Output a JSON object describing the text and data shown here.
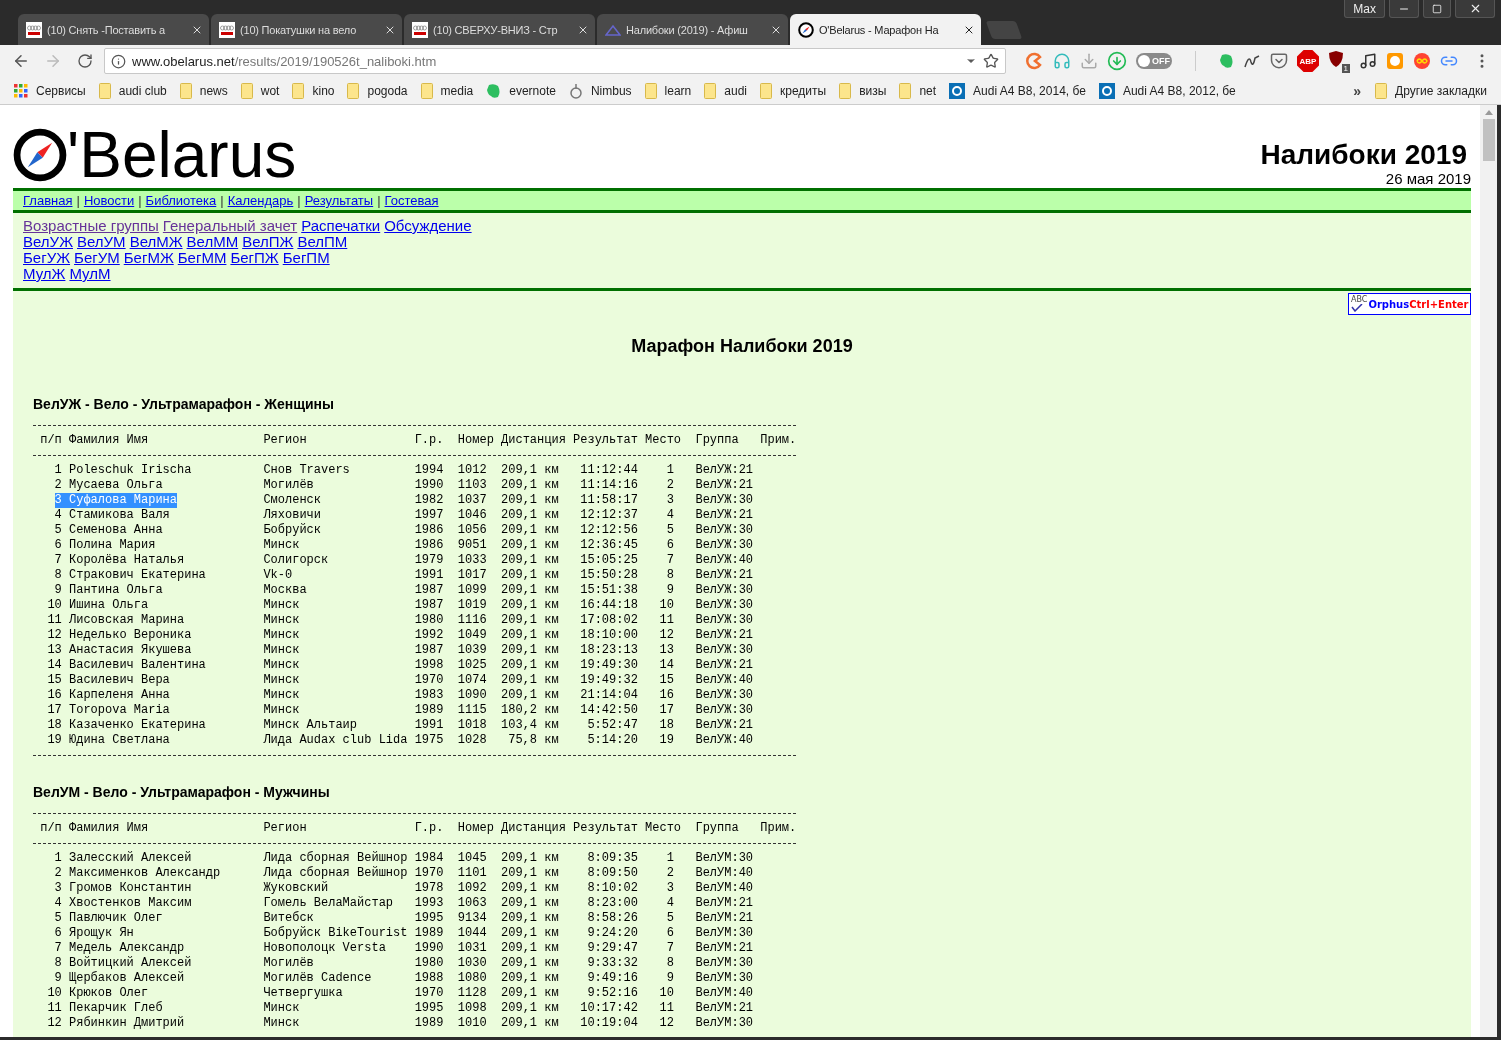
{
  "browser": {
    "profile": "Max",
    "tabs": [
      {
        "title": "(10) Снять -Поставить а",
        "kind": "audi",
        "selected": false
      },
      {
        "title": "(10) Покатушки на вело",
        "kind": "audi",
        "selected": false
      },
      {
        "title": "(10) СВЕРХУ-ВНИЗ - Стр",
        "kind": "audi",
        "selected": false
      },
      {
        "title": "Налибоки (2019) - Афиш",
        "kind": "afisha",
        "selected": false
      },
      {
        "title": "O'Belarus - Марафон На",
        "kind": "compass",
        "selected": true
      }
    ],
    "url": {
      "host": "www.obelarus.net",
      "path": "/results/2019/190526t_naliboki.htm"
    },
    "toggle": {
      "label": "OFF",
      "on": false
    },
    "abp": "ABP",
    "ublock_badge": "1",
    "bookmarks": [
      {
        "label": "Сервисы",
        "kind": "apps"
      },
      {
        "label": "audi club",
        "kind": "folder"
      },
      {
        "label": "news",
        "kind": "folder"
      },
      {
        "label": "wot",
        "kind": "folder"
      },
      {
        "label": "kino",
        "kind": "folder"
      },
      {
        "label": "pogoda",
        "kind": "folder"
      },
      {
        "label": "media",
        "kind": "folder"
      },
      {
        "label": "evernote",
        "kind": "evernote"
      },
      {
        "label": "Nimbus",
        "kind": "nimbus"
      },
      {
        "label": "learn",
        "kind": "folder"
      },
      {
        "label": "audi",
        "kind": "folder"
      },
      {
        "label": "кредиты",
        "kind": "folder"
      },
      {
        "label": "визы",
        "kind": "folder"
      },
      {
        "label": "net",
        "kind": "folder"
      },
      {
        "label": "Audi A4 B8, 2014, бе",
        "kind": "site"
      },
      {
        "label": "Audi A4 B8, 2012, бе",
        "kind": "site"
      }
    ],
    "more_bookmarks": "»",
    "other_bookmarks": "Другие закладки"
  },
  "page": {
    "logo": "'Belarus",
    "event_title": "Налибоки 2019",
    "event_date": "26 мая 2019",
    "nav": {
      "separator": "|",
      "links": [
        "Главная",
        "Новости",
        "Библиотека",
        "Календарь",
        "Результаты",
        "Гостевая"
      ]
    },
    "subnav": [
      [
        {
          "label": "Возрастные группы",
          "visited": true
        },
        {
          "label": "Генеральный зачет",
          "visited": true
        },
        {
          "label": "Распечатки",
          "visited": false
        },
        {
          "label": "Обсуждение",
          "visited": false
        }
      ],
      [
        {
          "label": "ВелУЖ",
          "visited": false
        },
        {
          "label": "ВелУМ",
          "visited": false
        },
        {
          "label": "ВелМЖ",
          "visited": false
        },
        {
          "label": "ВелММ",
          "visited": false
        },
        {
          "label": "ВелПЖ",
          "visited": false
        },
        {
          "label": "ВелПМ",
          "visited": false
        }
      ],
      [
        {
          "label": "БегУЖ",
          "visited": false
        },
        {
          "label": "БегУМ",
          "visited": false
        },
        {
          "label": "БегМЖ",
          "visited": false
        },
        {
          "label": "БегММ",
          "visited": false
        },
        {
          "label": "БегПЖ",
          "visited": false
        },
        {
          "label": "БегПМ",
          "visited": false
        }
      ],
      [
        {
          "label": "МулЖ",
          "visited": false
        },
        {
          "label": "МулМ",
          "visited": false
        }
      ]
    ],
    "orphus": {
      "icon_text": "ABC",
      "label": "Orphus",
      "shortcut": "Ctrl+Enter"
    },
    "heading": "Марафон Налибоки 2019",
    "sections": [
      {
        "title": "ВелУЖ - Вело - Ультрамарафон - Женщины",
        "columns": [
          "п/п",
          "Фамилия Имя",
          "Регион",
          "Г.р.",
          "Номер",
          "Дистанция",
          "Результат",
          "Место",
          "Группа",
          "Прим."
        ],
        "rows": [
          {
            "cells": [
              "1",
              "Poleschuk Irischa",
              "Снов Travers",
              "1994",
              "1012",
              "209,1 км",
              "11:12:44",
              "1",
              "ВелУЖ:21"
            ],
            "selected": false
          },
          {
            "cells": [
              "2",
              "Мусаева Ольга",
              "Могилёв",
              "1990",
              "1103",
              "209,1 км",
              "11:14:16",
              "2",
              "ВелУЖ:21"
            ],
            "selected": false
          },
          {
            "cells": [
              "3",
              "Суфалова Марина",
              "Смоленск",
              "1982",
              "1037",
              "209,1 км",
              "11:58:17",
              "3",
              "ВелУЖ:30"
            ],
            "selected": true
          },
          {
            "cells": [
              "4",
              "Стамикова Валя",
              "Ляховичи",
              "1997",
              "1046",
              "209,1 км",
              "12:12:37",
              "4",
              "ВелУЖ:21"
            ],
            "selected": false
          },
          {
            "cells": [
              "5",
              "Семенова Анна",
              "Бобруйск",
              "1986",
              "1056",
              "209,1 км",
              "12:12:56",
              "5",
              "ВелУЖ:30"
            ],
            "selected": false
          },
          {
            "cells": [
              "6",
              "Полина Мария",
              "Минск",
              "1986",
              "9051",
              "209,1 км",
              "12:36:45",
              "6",
              "ВелУЖ:30"
            ],
            "selected": false
          },
          {
            "cells": [
              "7",
              "Королёва Наталья",
              "Солигорск",
              "1979",
              "1033",
              "209,1 км",
              "15:05:25",
              "7",
              "ВелУЖ:40"
            ],
            "selected": false
          },
          {
            "cells": [
              "8",
              "Стракович Екатерина",
              "Vk-0",
              "1991",
              "1017",
              "209,1 км",
              "15:50:28",
              "8",
              "ВелУЖ:21"
            ],
            "selected": false
          },
          {
            "cells": [
              "9",
              "Пантина Ольга",
              "Москва",
              "1987",
              "1099",
              "209,1 км",
              "15:51:38",
              "9",
              "ВелУЖ:30"
            ],
            "selected": false
          },
          {
            "cells": [
              "10",
              "Ишина Ольга",
              "Минск",
              "1987",
              "1019",
              "209,1 км",
              "16:44:18",
              "10",
              "ВелУЖ:30"
            ],
            "selected": false
          },
          {
            "cells": [
              "11",
              "Лисовская Марина",
              "Минск",
              "1980",
              "1116",
              "209,1 км",
              "17:08:02",
              "11",
              "ВелУЖ:30"
            ],
            "selected": false
          },
          {
            "cells": [
              "12",
              "Неделько Вероника",
              "Минск",
              "1992",
              "1049",
              "209,1 км",
              "18:10:00",
              "12",
              "ВелУЖ:21"
            ],
            "selected": false
          },
          {
            "cells": [
              "13",
              "Анастасия Якушева",
              "Минск",
              "1987",
              "1039",
              "209,1 км",
              "18:23:13",
              "13",
              "ВелУЖ:30"
            ],
            "selected": false
          },
          {
            "cells": [
              "14",
              "Василевич Валентина",
              "Минск",
              "1998",
              "1025",
              "209,1 км",
              "19:49:30",
              "14",
              "ВелУЖ:21"
            ],
            "selected": false
          },
          {
            "cells": [
              "15",
              "Василевич Вера",
              "Минск",
              "1970",
              "1074",
              "209,1 км",
              "19:49:32",
              "15",
              "ВелУЖ:40"
            ],
            "selected": false
          },
          {
            "cells": [
              "16",
              "Карпеленя Анна",
              "Минск",
              "1983",
              "1090",
              "209,1 км",
              "21:14:04",
              "16",
              "ВелУЖ:30"
            ],
            "selected": false
          },
          {
            "cells": [
              "17",
              "Toropova Maria",
              "Минск",
              "1989",
              "1115",
              "180,2 км",
              "14:42:50",
              "17",
              "ВелУЖ:30"
            ],
            "selected": false
          },
          {
            "cells": [
              "18",
              "Казаченко Екатерина",
              "Минск Альтаир",
              "1991",
              "1018",
              "103,4 км",
              "5:52:47",
              "18",
              "ВелУЖ:21"
            ],
            "selected": false
          },
          {
            "cells": [
              "19",
              "Юдина Светлана",
              "Лида Audax club Lida",
              "1975",
              "1028",
              "75,8 км",
              "5:14:20",
              "19",
              "ВелУЖ:40"
            ],
            "selected": false
          }
        ]
      },
      {
        "title": "ВелУМ - Вело - Ультрамарафон - Мужчины",
        "columns": [
          "п/п",
          "Фамилия Имя",
          "Регион",
          "Г.р.",
          "Номер",
          "Дистанция",
          "Результат",
          "Место",
          "Группа",
          "Прим."
        ],
        "rows": [
          {
            "cells": [
              "1",
              "Залесский Алексей",
              "Лида сборная Вейшнор",
              "1984",
              "1045",
              "209,1 км",
              "8:09:35",
              "1",
              "ВелУМ:30"
            ],
            "selected": false
          },
          {
            "cells": [
              "2",
              "Максименков Александр",
              "Лида сборная Вейшнор",
              "1970",
              "1101",
              "209,1 км",
              "8:09:50",
              "2",
              "ВелУМ:40"
            ],
            "selected": false
          },
          {
            "cells": [
              "3",
              "Громов Константин",
              "Жуковский",
              "1978",
              "1092",
              "209,1 км",
              "8:10:02",
              "3",
              "ВелУМ:40"
            ],
            "selected": false
          },
          {
            "cells": [
              "4",
              "Хвостенков Максим",
              "Гомель ВелаМайстар",
              "1993",
              "1063",
              "209,1 км",
              "8:23:00",
              "4",
              "ВелУМ:21"
            ],
            "selected": false
          },
          {
            "cells": [
              "5",
              "Павлючик Олег",
              "Витебск",
              "1995",
              "9134",
              "209,1 км",
              "8:58:26",
              "5",
              "ВелУМ:21"
            ],
            "selected": false
          },
          {
            "cells": [
              "6",
              "Ярощук Ян",
              "Бобруйск BikeTourist",
              "1989",
              "1044",
              "209,1 км",
              "9:24:20",
              "6",
              "ВелУМ:30"
            ],
            "selected": false
          },
          {
            "cells": [
              "7",
              "Медель Александр",
              "Новополоцк Versta",
              "1990",
              "1031",
              "209,1 км",
              "9:29:47",
              "7",
              "ВелУМ:21"
            ],
            "selected": false
          },
          {
            "cells": [
              "8",
              "Войтицкий Алексей",
              "Могилёв",
              "1980",
              "1030",
              "209,1 км",
              "9:33:32",
              "8",
              "ВелУМ:30"
            ],
            "selected": false
          },
          {
            "cells": [
              "9",
              "Щербаков Алексей",
              "Могилёв Cadence",
              "1988",
              "1080",
              "209,1 км",
              "9:49:16",
              "9",
              "ВелУМ:30"
            ],
            "selected": false
          },
          {
            "cells": [
              "10",
              "Крюков Олег",
              "Четвергушка",
              "1970",
              "1128",
              "209,1 км",
              "9:52:16",
              "10",
              "ВелУМ:40"
            ],
            "selected": false
          },
          {
            "cells": [
              "11",
              "Пекарчик Глеб",
              "Минск",
              "1995",
              "1098",
              "209,1 км",
              "10:17:42",
              "11",
              "ВелУМ:21"
            ],
            "selected": false
          },
          {
            "cells": [
              "12",
              "Рябинкин Дмитрий",
              "Минск",
              "1989",
              "1010",
              "209,1 км",
              "10:19:04",
              "12",
              "ВелУМ:30"
            ],
            "selected": false
          }
        ]
      }
    ]
  }
}
